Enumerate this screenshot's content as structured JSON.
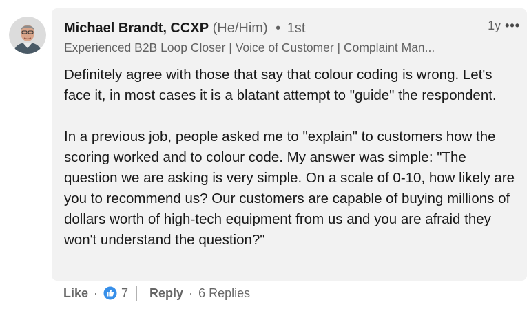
{
  "comment": {
    "author_name": "Michael Brandt, CCXP",
    "pronouns": "(He/Him)",
    "separator": "•",
    "degree": "1st",
    "time_ago": "1y",
    "more_label": "•••",
    "headline": "Experienced B2B Loop Closer | Voice of Customer | Complaint Man...",
    "paragraphs": [
      "Definitely agree with those that say that colour coding is wrong. Let's face it, in most cases it is a blatant attempt to \"guide\" the respondent.",
      "In a previous job, people asked me to \"explain\" to customers how the scoring worked and to colour code. My answer was simple: \"The question we are asking is very simple. On a scale of 0-10, how likely are you to recommend us? Our customers are capable of buying millions of dollars worth of high-tech equipment from us and you are afraid they won't understand the question?\""
    ]
  },
  "actions": {
    "like_label": "Like",
    "dot": "·",
    "reaction_icon": "thumbs-up-icon",
    "reaction_count": "7",
    "reply_label": "Reply",
    "replies_label": "6 Replies"
  },
  "colors": {
    "bubble_bg": "#f2f2f2",
    "like_blue": "#378fe9"
  }
}
